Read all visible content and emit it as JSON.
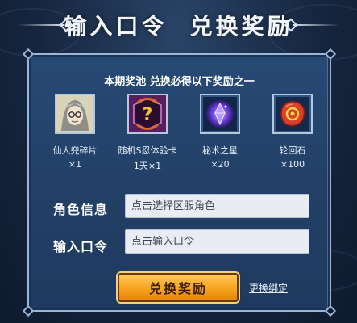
{
  "header": {
    "title_left": "输入口令",
    "title_right": "兑换奖励"
  },
  "panel": {
    "subtitle": "本期奖池 兑换必得以下奖励之一"
  },
  "rewards": [
    {
      "name": "仙人兜碎片",
      "qty": "×1",
      "icon": "ninja-portrait-icon"
    },
    {
      "name": "随机S忍体验卡",
      "qty": "1天×1",
      "icon": "mystery-card-icon"
    },
    {
      "name": "秘术之星",
      "qty": "×20",
      "icon": "purple-star-gem-icon"
    },
    {
      "name": "轮回石",
      "qty": "×100",
      "icon": "red-spiral-stone-icon"
    }
  ],
  "form": {
    "role_label": "角色信息",
    "role_placeholder": "点击选择区服角色",
    "code_label": "输入口令",
    "code_placeholder": "点击输入口令"
  },
  "actions": {
    "redeem_label": "兑换奖励",
    "rebind_label": "更换绑定"
  },
  "colors": {
    "panel": "#274a75",
    "panel_border": "#9bb6d6",
    "button_orange": "#f7a31e",
    "input_bg": "#e9edf3"
  }
}
